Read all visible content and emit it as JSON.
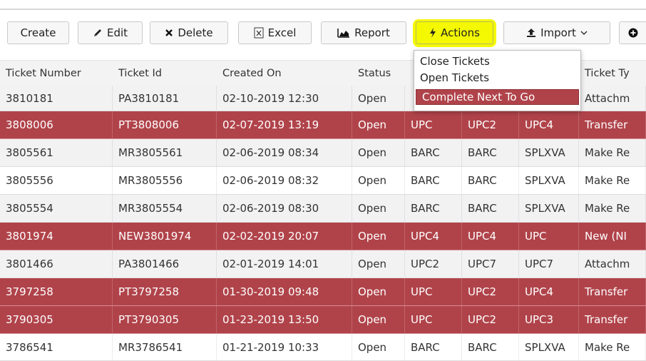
{
  "toolbar": {
    "create": "Create",
    "edit": "Edit",
    "delete": "Delete",
    "excel": "Excel",
    "report": "Report",
    "actions": "Actions",
    "import": "Import",
    "edit_icon": "pencil-icon",
    "delete_icon": "x-icon",
    "excel_icon": "excel-file-icon",
    "report_icon": "area-chart-icon",
    "actions_icon": "bolt-icon",
    "import_icon": "upload-icon",
    "more_icon": "plus-circle-icon"
  },
  "actions_menu": {
    "items": [
      "Close Tickets",
      "Open Tickets",
      "Complete Next To Go"
    ],
    "selected": "Complete Next To Go",
    "highlight_color": "#f4f800"
  },
  "grid": {
    "columns": [
      "Ticket Number",
      "Ticket Id",
      "Created On",
      "Status",
      "",
      "",
      "",
      "Ticket Ty"
    ],
    "rows": [
      {
        "c": [
          "3810181",
          "PA3810181",
          "02-10-2019 12:30",
          "Open",
          "",
          "",
          "",
          "Attachm"
        ],
        "style": "normal"
      },
      {
        "c": [
          "3808006",
          "PT3808006",
          "02-07-2019 13:19",
          "Open",
          "UPC",
          "UPC2",
          "UPC4",
          "Transfer"
        ],
        "style": "red"
      },
      {
        "c": [
          "3805561",
          "MR3805561",
          "02-06-2019 08:34",
          "Open",
          "BARC",
          "BARC",
          "SPLXVA",
          "Make Re"
        ],
        "style": "normal"
      },
      {
        "c": [
          "3805556",
          "MR3805556",
          "02-06-2019 08:32",
          "Open",
          "BARC",
          "BARC",
          "SPLXVA",
          "Make Re"
        ],
        "style": "alt"
      },
      {
        "c": [
          "3805554",
          "MR3805554",
          "02-06-2019 08:30",
          "Open",
          "BARC",
          "BARC",
          "SPLXVA",
          "Make Re"
        ],
        "style": "normal"
      },
      {
        "c": [
          "3801974",
          "NEW3801974",
          "02-02-2019 20:07",
          "Open",
          "UPC4",
          "UPC4",
          "UPC",
          "New (NI"
        ],
        "style": "red"
      },
      {
        "c": [
          "3801466",
          "PA3801466",
          "02-01-2019 14:01",
          "Open",
          "UPC2",
          "UPC7",
          "UPC7",
          "Attachm"
        ],
        "style": "normal"
      },
      {
        "c": [
          "3797258",
          "PT3797258",
          "01-30-2019 09:48",
          "Open",
          "UPC",
          "UPC2",
          "UPC4",
          "Transfer"
        ],
        "style": "red"
      },
      {
        "c": [
          "3790305",
          "PT3790305",
          "01-23-2019 13:50",
          "Open",
          "UPC",
          "UPC2",
          "UPC3",
          "Transfer"
        ],
        "style": "red"
      },
      {
        "c": [
          "3786541",
          "MR3786541",
          "01-21-2019 10:33",
          "Open",
          "BARC",
          "BARC",
          "SPLXVA",
          "Make Re"
        ],
        "style": "alt"
      }
    ],
    "colors": {
      "red_row": "#b0434a",
      "normal_row": "#f2f2f2",
      "alt_row": "#ffffff"
    }
  }
}
